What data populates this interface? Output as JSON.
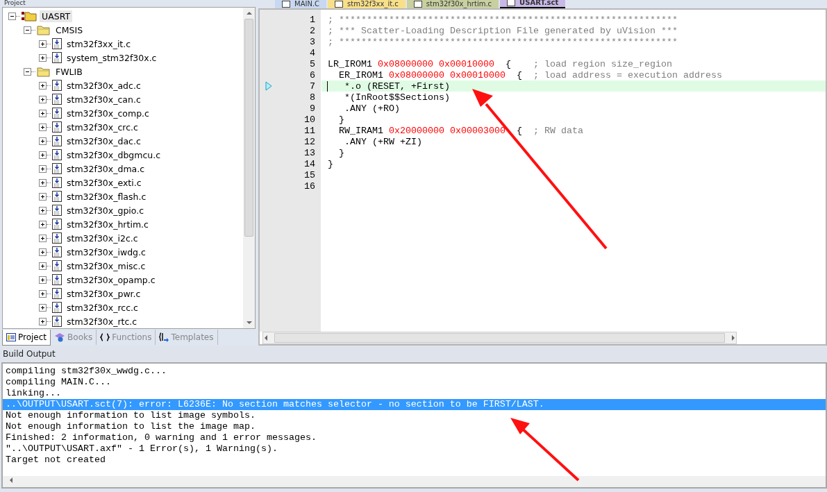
{
  "project_panel": {
    "title": "Project",
    "tree": [
      {
        "label": "UASRT",
        "kind": "project",
        "expanded": true,
        "selected": true,
        "children": [
          {
            "label": "CMSIS",
            "kind": "group",
            "expanded": true,
            "selected": false,
            "children": [
              {
                "label": "stm32f3xx_it.c",
                "kind": "file",
                "expanded": false,
                "selected": false
              },
              {
                "label": "system_stm32f30x.c",
                "kind": "file",
                "expanded": false,
                "selected": false
              }
            ]
          },
          {
            "label": "FWLIB",
            "kind": "group",
            "expanded": true,
            "selected": false,
            "children": [
              {
                "label": "stm32f30x_adc.c",
                "kind": "file",
                "expanded": false,
                "selected": false
              },
              {
                "label": "stm32f30x_can.c",
                "kind": "file",
                "expanded": false,
                "selected": false
              },
              {
                "label": "stm32f30x_comp.c",
                "kind": "file",
                "expanded": false,
                "selected": false
              },
              {
                "label": "stm32f30x_crc.c",
                "kind": "file",
                "expanded": false,
                "selected": false
              },
              {
                "label": "stm32f30x_dac.c",
                "kind": "file",
                "expanded": false,
                "selected": false
              },
              {
                "label": "stm32f30x_dbgmcu.c",
                "kind": "file",
                "expanded": false,
                "selected": false
              },
              {
                "label": "stm32f30x_dma.c",
                "kind": "file",
                "expanded": false,
                "selected": false
              },
              {
                "label": "stm32f30x_exti.c",
                "kind": "file",
                "expanded": false,
                "selected": false
              },
              {
                "label": "stm32f30x_flash.c",
                "kind": "file",
                "expanded": false,
                "selected": false
              },
              {
                "label": "stm32f30x_gpio.c",
                "kind": "file",
                "expanded": false,
                "selected": false
              },
              {
                "label": "stm32f30x_hrtim.c",
                "kind": "file",
                "expanded": false,
                "selected": false
              },
              {
                "label": "stm32f30x_i2c.c",
                "kind": "file",
                "expanded": false,
                "selected": false
              },
              {
                "label": "stm32f30x_iwdg.c",
                "kind": "file",
                "expanded": false,
                "selected": false
              },
              {
                "label": "stm32f30x_misc.c",
                "kind": "file",
                "expanded": false,
                "selected": false
              },
              {
                "label": "stm32f30x_opamp.c",
                "kind": "file",
                "expanded": false,
                "selected": false
              },
              {
                "label": "stm32f30x_pwr.c",
                "kind": "file",
                "expanded": false,
                "selected": false
              },
              {
                "label": "stm32f30x_rcc.c",
                "kind": "file",
                "expanded": false,
                "selected": false
              },
              {
                "label": "stm32f30x_rtc.c",
                "kind": "file",
                "expanded": false,
                "selected": false
              }
            ]
          }
        ]
      }
    ],
    "tabs": [
      {
        "label": "Project",
        "kind": "project",
        "selected": true
      },
      {
        "label": "Books",
        "kind": "books",
        "selected": false
      },
      {
        "label": "Functions",
        "kind": "functions",
        "selected": false
      },
      {
        "label": "Templates",
        "kind": "templates",
        "selected": false
      }
    ]
  },
  "editor": {
    "tabs": [
      {
        "label": "MAIN.C",
        "color": "#c8d8f0",
        "selected": false
      },
      {
        "label": "stm32f3xx_it.c",
        "color": "#f8e08a",
        "selected": false
      },
      {
        "label": "stm32f30x_hrtim.c",
        "color": "#c8d0a0",
        "selected": false
      },
      {
        "label": "USART.sct",
        "color": "#c8b8e8",
        "selected": true
      }
    ],
    "lines": [
      {
        "number": "1",
        "current": false,
        "segments": [
          {
            "kind": "comment",
            "text": "; *************************************************************"
          }
        ]
      },
      {
        "number": "2",
        "current": false,
        "segments": [
          {
            "kind": "comment",
            "text": "; *** Scatter-Loading Description File generated by uVision ***"
          }
        ]
      },
      {
        "number": "3",
        "current": false,
        "segments": [
          {
            "kind": "comment",
            "text": "; *************************************************************"
          }
        ]
      },
      {
        "number": "4",
        "current": false
      },
      {
        "number": "5",
        "current": false,
        "segments": [
          {
            "kind": "plain",
            "text": "LR_IROM1 "
          },
          {
            "kind": "number",
            "text": "0x08000000 0x00010000"
          },
          {
            "kind": "plain",
            "text": "  {    "
          },
          {
            "kind": "comment",
            "text": "; load region size_region"
          }
        ]
      },
      {
        "number": "6",
        "current": false,
        "segments": [
          {
            "kind": "plain",
            "text": "  ER_IROM1 "
          },
          {
            "kind": "number",
            "text": "0x08000000 0x00010000"
          },
          {
            "kind": "plain",
            "text": "  {  "
          },
          {
            "kind": "comment",
            "text": "; load address = execution address"
          }
        ]
      },
      {
        "number": "7",
        "current": true,
        "segments": [
          {
            "kind": "plain",
            "text": "   *.o (RESET, +First)"
          }
        ]
      },
      {
        "number": "8",
        "current": false,
        "segments": [
          {
            "kind": "plain",
            "text": "   *(InRoot$$Sections)"
          }
        ]
      },
      {
        "number": "9",
        "current": false,
        "segments": [
          {
            "kind": "plain",
            "text": "   .ANY (+RO)"
          }
        ]
      },
      {
        "number": "10",
        "current": false,
        "segments": [
          {
            "kind": "plain",
            "text": "  }"
          }
        ]
      },
      {
        "number": "11",
        "current": false,
        "segments": [
          {
            "kind": "plain",
            "text": "  RW_IRAM1 "
          },
          {
            "kind": "number",
            "text": "0x20000000 0x00003000"
          },
          {
            "kind": "plain",
            "text": "  {  "
          },
          {
            "kind": "comment",
            "text": "; RW data"
          }
        ]
      },
      {
        "number": "12",
        "current": false,
        "segments": [
          {
            "kind": "plain",
            "text": "   .ANY (+RW +ZI)"
          }
        ]
      },
      {
        "number": "13",
        "current": false,
        "segments": [
          {
            "kind": "plain",
            "text": "  }"
          }
        ]
      },
      {
        "number": "14",
        "current": false,
        "segments": [
          {
            "kind": "plain",
            "text": "}"
          }
        ]
      },
      {
        "number": "15",
        "current": false
      },
      {
        "number": "16",
        "current": false
      }
    ]
  },
  "build_output": {
    "title": "Build Output",
    "lines": [
      {
        "text": "compiling stm32f30x_wwdg.c...",
        "selected": false
      },
      {
        "text": "compiling MAIN.C...",
        "selected": false
      },
      {
        "text": "linking...",
        "selected": false
      },
      {
        "text": "..\\OUTPUT\\USART.sct(7): error: L6236E: No section matches selector - no section to be FIRST/LAST.",
        "selected": true
      },
      {
        "text": "Not enough information to list image symbols.",
        "selected": false
      },
      {
        "text": "Not enough information to list the image map.",
        "selected": false
      },
      {
        "text": "Finished: 2 information, 0 warning and 1 error messages.",
        "selected": false
      },
      {
        "text": "\"..\\OUTPUT\\USART.axf\" - 1 Error(s), 1 Warning(s).",
        "selected": false
      },
      {
        "text": "Target not created",
        "selected": false
      }
    ]
  }
}
